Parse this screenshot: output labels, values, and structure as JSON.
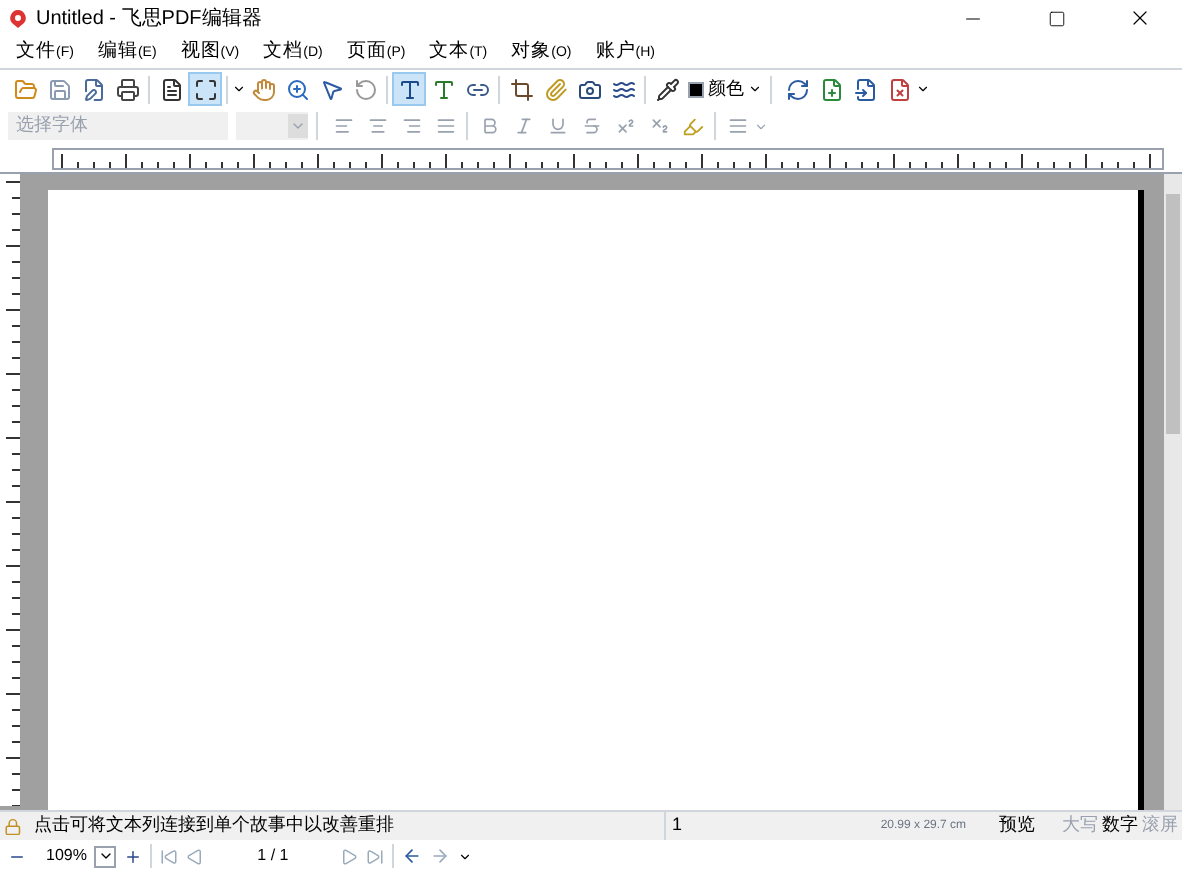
{
  "window": {
    "title": "Untitled - 飞思PDF编辑器"
  },
  "menu": [
    {
      "label": "文件",
      "key": "(F)"
    },
    {
      "label": "编辑",
      "key": "(E)"
    },
    {
      "label": "视图",
      "key": "(V)"
    },
    {
      "label": "文档",
      "key": "(D)"
    },
    {
      "label": "页面",
      "key": "(P)"
    },
    {
      "label": "文本",
      "key": "(T)"
    },
    {
      "label": "对象",
      "key": "(O)"
    },
    {
      "label": "账户",
      "key": "(H)"
    }
  ],
  "toolbar": {
    "tools": [
      {
        "selected": false
      },
      {
        "selected": false
      },
      {
        "selected": false
      },
      {
        "selected": false
      },
      {
        "selected": false
      },
      {
        "selected": true
      },
      {
        "selected": false
      },
      {
        "selected": false
      },
      {
        "selected": false
      },
      {
        "selected": false
      },
      {
        "selected": true
      },
      {
        "selected": false
      },
      {
        "selected": false
      },
      {
        "selected": false
      },
      {
        "selected": false
      },
      {
        "selected": false
      },
      {
        "selected": false
      }
    ],
    "color_label": "颜色"
  },
  "format_bar": {
    "font_placeholder": "选择字体",
    "disabled": true
  },
  "status_bar": {
    "hint": "点击可将文本列连接到单个故事中以改善重排",
    "page_number": "1",
    "page_size": "20.99 x 29.7 cm",
    "mode": "预览",
    "indicators": [
      {
        "label": "大写",
        "active": false
      },
      {
        "label": "数字",
        "active": true
      },
      {
        "label": "滚屏",
        "active": false
      }
    ]
  },
  "navigation": {
    "zoom": "109%",
    "page": "1 / 1"
  }
}
